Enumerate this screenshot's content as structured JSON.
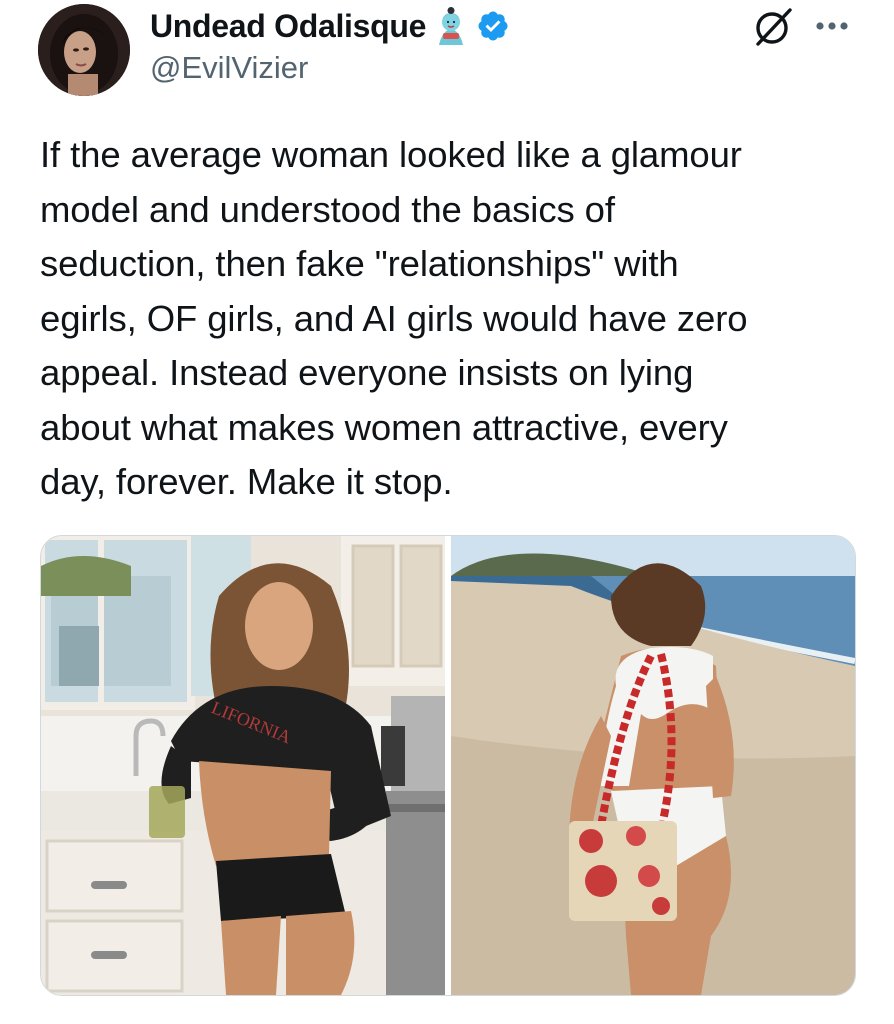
{
  "author": {
    "display_name": "Undead Odalisque",
    "handle": "@EvilVizier",
    "avatar_icon": "profile-photo",
    "badge_icons": [
      "genie-emoji-icon",
      "verified-badge-icon"
    ],
    "verified_color": "#1d9bf0"
  },
  "header_actions": {
    "grok_icon": "grok-icon",
    "more_icon": "more-icon"
  },
  "tweet": {
    "text_lines": [
      "If the average woman looked like a glamour",
      "model and understood the basics of",
      "seduction, then fake \"relationships\" with",
      "egirls, OF girls, and AI girls would have zero",
      "appeal. Instead everyone insists on lying",
      "about what makes women attractive, every",
      "day, forever. Make it stop."
    ]
  },
  "media": {
    "photos": [
      {
        "name": "kitchen-photo",
        "shirt_text": "LIFORNIA"
      },
      {
        "name": "beach-photo"
      }
    ]
  },
  "colors": {
    "text_primary": "#0f1419",
    "text_secondary": "#536471",
    "border": "#cfd9de"
  }
}
